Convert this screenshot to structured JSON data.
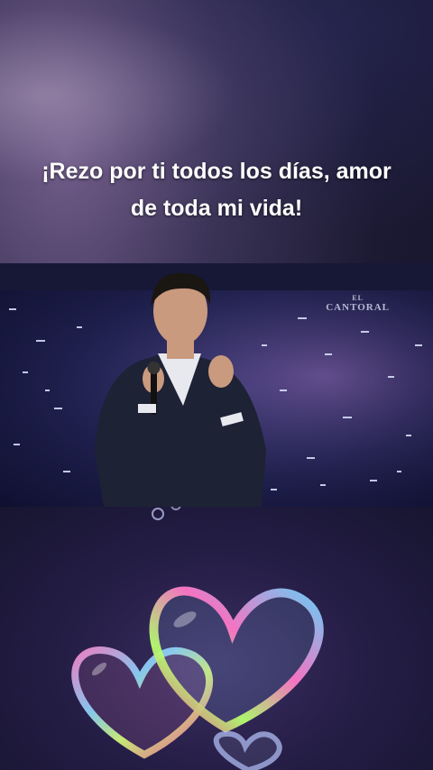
{
  "caption": {
    "text": "¡Rezo por ti todos los días, amor de toda mi vida!"
  },
  "video": {
    "watermark_line1": "EL",
    "watermark_line2": "CANTORAL"
  },
  "colors": {
    "background": "#1c1a33",
    "caption_text": "#ffffff",
    "suit": "#1d2235"
  },
  "icons": {
    "microphone": "microphone-icon",
    "hearts": "heart-bubble-icon"
  }
}
